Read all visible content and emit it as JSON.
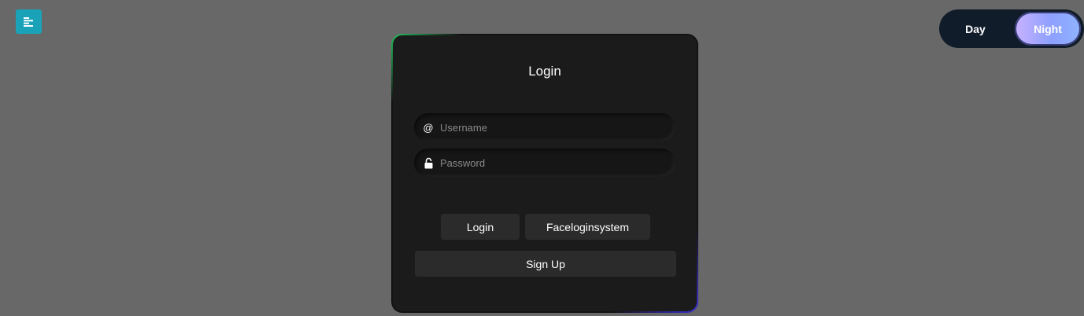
{
  "menu": {
    "icon": "menu-align-left-icon"
  },
  "theme_toggle": {
    "day_label": "Day",
    "night_label": "Night",
    "active": "Night"
  },
  "login_form": {
    "title": "Login",
    "username": {
      "placeholder": "Username",
      "value": "",
      "icon": "at-sign-icon"
    },
    "password": {
      "placeholder": "Password",
      "value": "",
      "icon": "lock-icon"
    },
    "login_button": "Login",
    "face_button": "Faceloginsystem",
    "signup_button": "Sign Up"
  },
  "colors": {
    "background": "#686868",
    "card": "#1b1b1b",
    "menu_button": "#1aa3b8",
    "toggle_track": "#111c2a"
  }
}
